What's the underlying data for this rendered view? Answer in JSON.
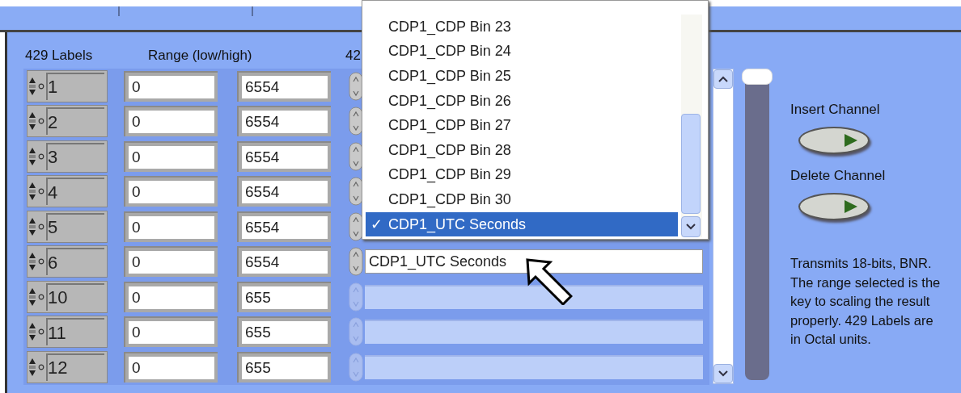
{
  "columns": [
    {
      "label": "429 Labels"
    },
    {
      "label": "Range (low/high)"
    },
    {
      "label": "42"
    }
  ],
  "rows": [
    {
      "label": "1",
      "low": "0",
      "high": "6554"
    },
    {
      "label": "2",
      "low": "0",
      "high": "6554"
    },
    {
      "label": "3",
      "low": "0",
      "high": "6554"
    },
    {
      "label": "4",
      "low": "0",
      "high": "6554"
    },
    {
      "label": "5",
      "low": "0",
      "high": "6554"
    },
    {
      "label": "6",
      "low": "0",
      "high": "6554"
    },
    {
      "label": "10",
      "low": "0",
      "high": "655"
    },
    {
      "label": "11",
      "low": "0",
      "high": "655"
    },
    {
      "label": "12",
      "low": "0",
      "high": "655"
    }
  ],
  "channels": [
    {
      "value": "CDP1_UTC Seconds",
      "disabled": false
    },
    {
      "disabled": true
    },
    {
      "disabled": true
    },
    {
      "disabled": true
    }
  ],
  "dropdown": {
    "mark": "✓",
    "items": [
      {
        "label": "CDP1_CDP Bin 23",
        "selected": false
      },
      {
        "label": "CDP1_CDP Bin 24",
        "selected": false
      },
      {
        "label": "CDP1_CDP Bin 25",
        "selected": false
      },
      {
        "label": "CDP1_CDP Bin 26",
        "selected": false
      },
      {
        "label": "CDP1_CDP Bin 27",
        "selected": false
      },
      {
        "label": "CDP1_CDP Bin 28",
        "selected": false
      },
      {
        "label": "CDP1_CDP Bin 29",
        "selected": false
      },
      {
        "label": "CDP1_CDP Bin 30",
        "selected": false
      },
      {
        "label": "CDP1_UTC Seconds",
        "selected": true
      }
    ]
  },
  "slider": {
    "level": 1
  },
  "buttons": [
    {
      "label": "Insert Channel"
    },
    {
      "label": "Delete Channel"
    }
  ],
  "note": "Transmits 18-bits, BNR.  The range selected is the key to scaling the result properly. 429 Labels are in Octal units."
}
